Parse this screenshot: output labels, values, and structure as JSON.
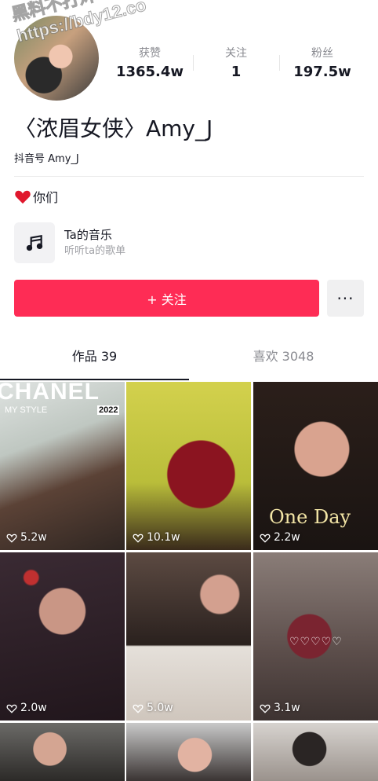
{
  "watermark": {
    "text": "黑料不打烊\nhttps://bdy12.co"
  },
  "stats": [
    {
      "label": "获赞",
      "value": "1365.4w"
    },
    {
      "label": "关注",
      "value": "1"
    },
    {
      "label": "粉丝",
      "value": "197.5w"
    }
  ],
  "profile": {
    "name": "〈浓眉女侠〉Amy_J",
    "douyin_id": "抖音号 Amy_J",
    "bio": "你们"
  },
  "music": {
    "title": "Ta的音乐",
    "subtitle": "听听ta的歌单",
    "icon": "music-note-icon"
  },
  "actions": {
    "follow_label": "+ 关注",
    "more_label": "···"
  },
  "tabs": [
    {
      "label": "作品 39",
      "active": true
    },
    {
      "label": "喜欢 3048",
      "active": false
    }
  ],
  "videos": [
    {
      "likes": "5.2w",
      "overlay": "CHANEL",
      "overlay2": "MY STYLE",
      "overlay3": "2022"
    },
    {
      "likes": "10.1w",
      "overlay": "",
      "overlay2": "",
      "overlay3": ""
    },
    {
      "likes": "2.2w",
      "overlay": "One  Day",
      "overlay2": "",
      "overlay3": ""
    },
    {
      "likes": "2.0w",
      "overlay": "",
      "overlay2": "",
      "overlay3": ""
    },
    {
      "likes": "5.0w",
      "overlay": "",
      "overlay2": "",
      "overlay3": ""
    },
    {
      "likes": "3.1w",
      "overlay": "♡♡♡♡♡",
      "overlay2": "",
      "overlay3": ""
    },
    {
      "likes": "",
      "overlay": "",
      "overlay2": "",
      "overlay3": ""
    },
    {
      "likes": "",
      "overlay": "",
      "overlay2": "",
      "overlay3": ""
    },
    {
      "likes": "",
      "overlay": "",
      "overlay2": "",
      "overlay3": ""
    }
  ],
  "colors": {
    "accent": "#fe2c55",
    "text": "#161823",
    "muted": "#8a8b91"
  }
}
